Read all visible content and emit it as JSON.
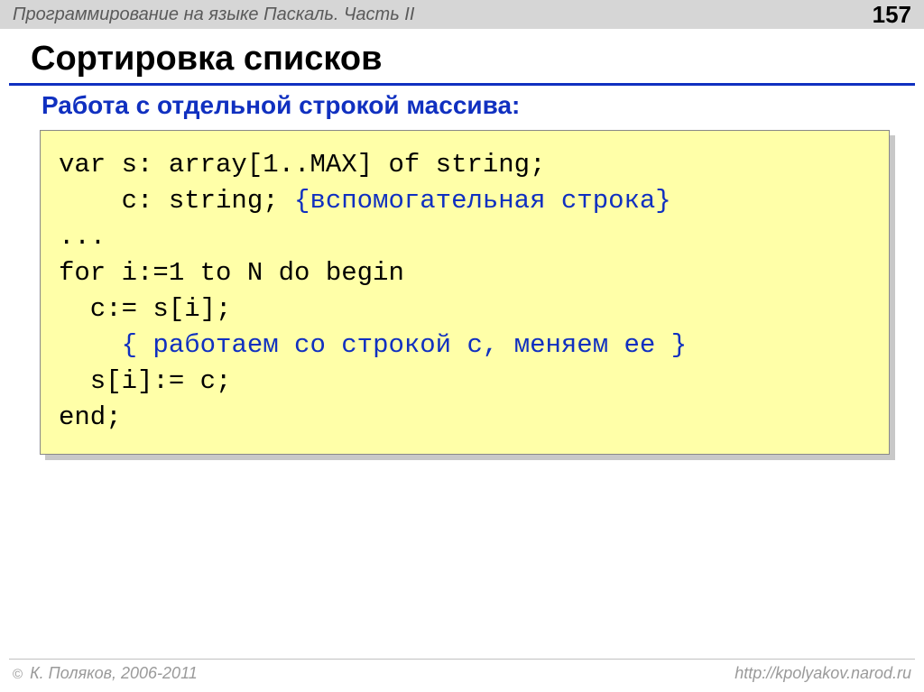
{
  "header": {
    "left": "Программирование на языке Паскаль. Часть II",
    "page": "157"
  },
  "title": "Сортировка списков",
  "subtitle": "Работа с отдельной строкой массива:",
  "code": {
    "l1": "var s: array[1..MAX] of string;",
    "l2a": "    c: string; ",
    "l2b": "{вспомогательная строка}",
    "l3": "...",
    "l4": "for i:=1 to N do begin",
    "l5": "  c:= s[i];",
    "l6a": "    ",
    "l6b": "{ работаем со строкой c, меняем ее }",
    "l7": "  s[i]:= c;",
    "l8": "end;"
  },
  "footer": {
    "copyright_symbol": "©",
    "left": " К. Поляков, 2006-2011",
    "right": "http://kpolyakov.narod.ru"
  }
}
